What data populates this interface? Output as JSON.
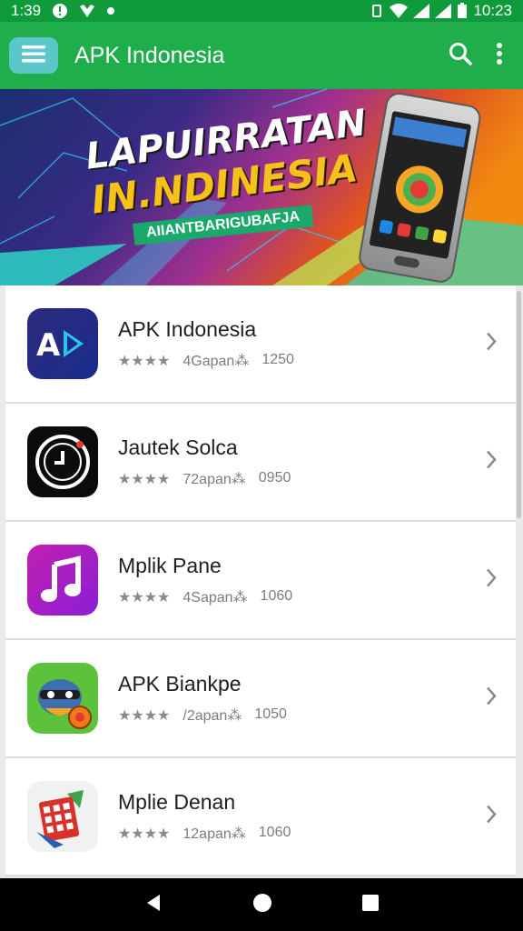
{
  "status_bar": {
    "time_left": "1:39",
    "time_right": "10:23"
  },
  "app_bar": {
    "title": "APK Indonesia",
    "icons": [
      "menu-icon",
      "search-icon",
      "more-vert-icon"
    ]
  },
  "banner": {
    "line1": "LAPUIRRATAN",
    "line2": "IN.NDINESIA",
    "subtitle": "AIIANTBARIGUBAFJA"
  },
  "apps": [
    {
      "name": "APK Indonesia",
      "stars": "★★★★",
      "downloads": "4Gapan⁂",
      "size": "1250",
      "icon": "play-icon"
    },
    {
      "name": "Jautek Solca",
      "stars": "★★★★",
      "downloads": "72apan⁂",
      "size": "0950",
      "icon": "clock-icon"
    },
    {
      "name": "Mplik Pane",
      "stars": "★★★★",
      "downloads": "4Sapan⁂",
      "size": "1060",
      "icon": "music-note-icon"
    },
    {
      "name": "APK Biankpe",
      "stars": "★★★★",
      "downloads": "/2apan⁂",
      "size": "1050",
      "icon": "cartoon-icon"
    },
    {
      "name": "Mplie Denan",
      "stars": "★★★★",
      "downloads": "12apan⁂",
      "size": "1060",
      "icon": "calendar-icon"
    }
  ],
  "colors": {
    "appbar": "#1fae4b",
    "statusbar": "#0f9b3c",
    "navbar": "#000000"
  }
}
